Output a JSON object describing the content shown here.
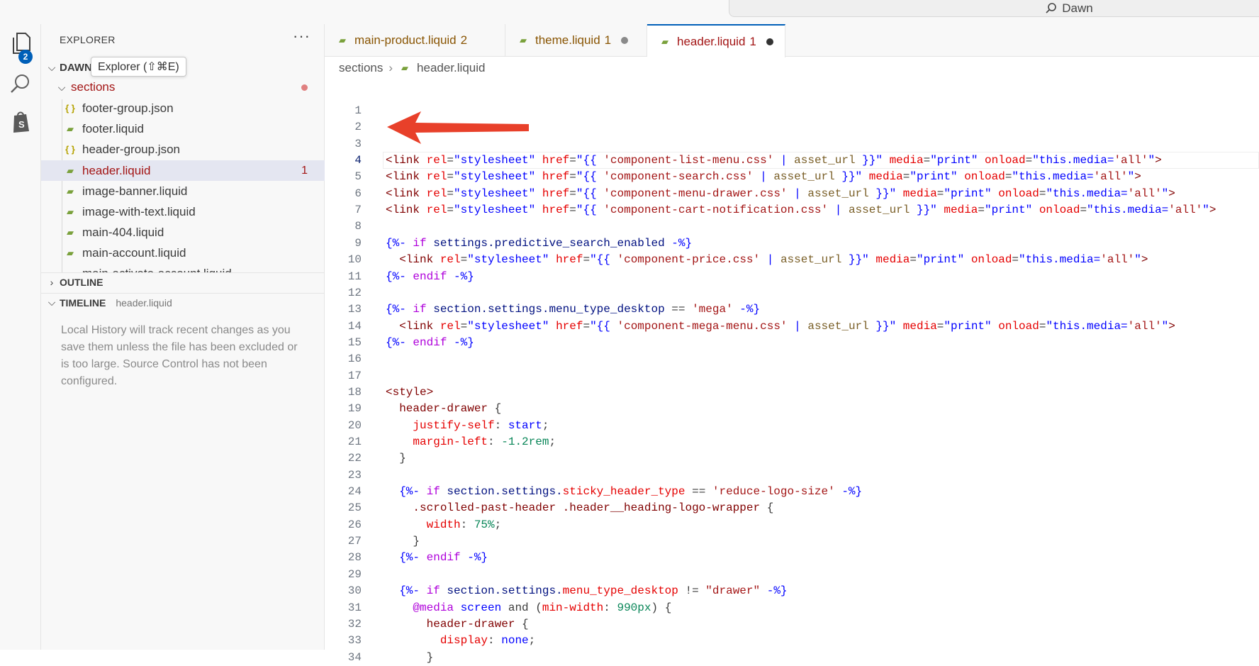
{
  "window": {
    "search_label": "Dawn"
  },
  "activity_bar": {
    "explorer_badge": "2"
  },
  "sidebar": {
    "header": "EXPLORER",
    "more": "···",
    "root_label": "DAWN",
    "tooltip": "Explorer (⇧⌘E)",
    "folder": "sections",
    "files": [
      {
        "name": "footer-group.json",
        "type": "json",
        "count": ""
      },
      {
        "name": "footer.liquid",
        "type": "liquid",
        "count": ""
      },
      {
        "name": "header-group.json",
        "type": "json",
        "count": ""
      },
      {
        "name": "header.liquid",
        "type": "liquid",
        "count": "1"
      },
      {
        "name": "image-banner.liquid",
        "type": "liquid",
        "count": ""
      },
      {
        "name": "image-with-text.liquid",
        "type": "liquid",
        "count": ""
      },
      {
        "name": "main-404.liquid",
        "type": "liquid",
        "count": ""
      },
      {
        "name": "main-account.liquid",
        "type": "liquid",
        "count": ""
      },
      {
        "name": "main-activate-account.liquid",
        "type": "liquid",
        "count": ""
      }
    ],
    "outline": "OUTLINE",
    "timeline": "TIMELINE",
    "timeline_file": "header.liquid",
    "timeline_text": "Local History will track recent changes as you save them unless the file has been excluded or is too large. Source Control has not been configured."
  },
  "tabs": [
    {
      "name": "main-product.liquid",
      "count": "2",
      "dot": false
    },
    {
      "name": "theme.liquid",
      "count": "1",
      "dot": true
    },
    {
      "name": "header.liquid",
      "count": "1",
      "dot": true
    }
  ],
  "breadcrumb": {
    "folder": "sections",
    "file": "header.liquid"
  },
  "code": {
    "current_line": 4,
    "lines": [
      [],
      [],
      [],
      [
        [
          "t",
          "<link "
        ],
        [
          "a",
          "rel"
        ],
        [
          "c",
          "="
        ],
        [
          "s",
          "\"stylesheet\" "
        ],
        [
          "a",
          "href"
        ],
        [
          "c",
          "="
        ],
        [
          "s",
          "\"{{ "
        ],
        [
          "q",
          "'component-list-menu.css'"
        ],
        [
          "s",
          " | "
        ],
        [
          "f",
          "asset_url"
        ],
        [
          "s",
          " }}\" "
        ],
        [
          "a",
          "media"
        ],
        [
          "c",
          "="
        ],
        [
          "s",
          "\"print\" "
        ],
        [
          "a",
          "onload"
        ],
        [
          "c",
          "="
        ],
        [
          "s",
          "\"this.media="
        ],
        [
          "q",
          "'all'"
        ],
        [
          "s",
          "\""
        ],
        [
          "t",
          ">"
        ]
      ],
      [
        [
          "t",
          "<link "
        ],
        [
          "a",
          "rel"
        ],
        [
          "c",
          "="
        ],
        [
          "s",
          "\"stylesheet\" "
        ],
        [
          "a",
          "href"
        ],
        [
          "c",
          "="
        ],
        [
          "s",
          "\"{{ "
        ],
        [
          "q",
          "'component-search.css'"
        ],
        [
          "s",
          " | "
        ],
        [
          "f",
          "asset_url"
        ],
        [
          "s",
          " }}\" "
        ],
        [
          "a",
          "media"
        ],
        [
          "c",
          "="
        ],
        [
          "s",
          "\"print\" "
        ],
        [
          "a",
          "onload"
        ],
        [
          "c",
          "="
        ],
        [
          "s",
          "\"this.media="
        ],
        [
          "q",
          "'all'"
        ],
        [
          "s",
          "\""
        ],
        [
          "t",
          ">"
        ]
      ],
      [
        [
          "t",
          "<link "
        ],
        [
          "a",
          "rel"
        ],
        [
          "c",
          "="
        ],
        [
          "s",
          "\"stylesheet\" "
        ],
        [
          "a",
          "href"
        ],
        [
          "c",
          "="
        ],
        [
          "s",
          "\"{{ "
        ],
        [
          "q",
          "'component-menu-drawer.css'"
        ],
        [
          "s",
          " | "
        ],
        [
          "f",
          "asset_url"
        ],
        [
          "s",
          " }}\" "
        ],
        [
          "a",
          "media"
        ],
        [
          "c",
          "="
        ],
        [
          "s",
          "\"print\" "
        ],
        [
          "a",
          "onload"
        ],
        [
          "c",
          "="
        ],
        [
          "s",
          "\"this.media="
        ],
        [
          "q",
          "'all'"
        ],
        [
          "s",
          "\""
        ],
        [
          "t",
          ">"
        ]
      ],
      [
        [
          "t",
          "<link "
        ],
        [
          "a",
          "rel"
        ],
        [
          "c",
          "="
        ],
        [
          "s",
          "\"stylesheet\" "
        ],
        [
          "a",
          "href"
        ],
        [
          "c",
          "="
        ],
        [
          "s",
          "\"{{ "
        ],
        [
          "q",
          "'component-cart-notification.css'"
        ],
        [
          "s",
          " | "
        ],
        [
          "f",
          "asset_url"
        ],
        [
          "s",
          " }}\" "
        ],
        [
          "a",
          "media"
        ],
        [
          "c",
          "="
        ],
        [
          "s",
          "\"print\" "
        ],
        [
          "a",
          "onload"
        ],
        [
          "c",
          "="
        ],
        [
          "s",
          "\"this.media="
        ],
        [
          "q",
          "'all'"
        ],
        [
          "s",
          "\""
        ],
        [
          "t",
          ">"
        ]
      ],
      [],
      [
        [
          "k",
          "{%- "
        ],
        [
          "p",
          "if "
        ],
        [
          "v",
          "settings.predictive_search_enabled"
        ],
        [
          "k",
          " -%}"
        ]
      ],
      [
        [
          "c",
          "  "
        ],
        [
          "t",
          "<link "
        ],
        [
          "a",
          "rel"
        ],
        [
          "c",
          "="
        ],
        [
          "s",
          "\"stylesheet\" "
        ],
        [
          "a",
          "href"
        ],
        [
          "c",
          "="
        ],
        [
          "s",
          "\"{{ "
        ],
        [
          "q",
          "'component-price.css'"
        ],
        [
          "s",
          " | "
        ],
        [
          "f",
          "asset_url"
        ],
        [
          "s",
          " }}\" "
        ],
        [
          "a",
          "media"
        ],
        [
          "c",
          "="
        ],
        [
          "s",
          "\"print\" "
        ],
        [
          "a",
          "onload"
        ],
        [
          "c",
          "="
        ],
        [
          "s",
          "\"this.media="
        ],
        [
          "q",
          "'all'"
        ],
        [
          "s",
          "\""
        ],
        [
          "t",
          ">"
        ]
      ],
      [
        [
          "k",
          "{%- "
        ],
        [
          "p",
          "endif"
        ],
        [
          "k",
          " -%}"
        ]
      ],
      [],
      [
        [
          "k",
          "{%- "
        ],
        [
          "p",
          "if "
        ],
        [
          "v",
          "section.settings.menu_type_desktop"
        ],
        [
          "c",
          " == "
        ],
        [
          "q",
          "'mega'"
        ],
        [
          "k",
          " -%}"
        ]
      ],
      [
        [
          "c",
          "  "
        ],
        [
          "t",
          "<link "
        ],
        [
          "a",
          "rel"
        ],
        [
          "c",
          "="
        ],
        [
          "s",
          "\"stylesheet\" "
        ],
        [
          "a",
          "href"
        ],
        [
          "c",
          "="
        ],
        [
          "s",
          "\"{{ "
        ],
        [
          "q",
          "'component-mega-menu.css'"
        ],
        [
          "s",
          " | "
        ],
        [
          "f",
          "asset_url"
        ],
        [
          "s",
          " }}\" "
        ],
        [
          "a",
          "media"
        ],
        [
          "c",
          "="
        ],
        [
          "s",
          "\"print\" "
        ],
        [
          "a",
          "onload"
        ],
        [
          "c",
          "="
        ],
        [
          "s",
          "\"this.media="
        ],
        [
          "q",
          "'all'"
        ],
        [
          "s",
          "\""
        ],
        [
          "t",
          ">"
        ]
      ],
      [
        [
          "k",
          "{%- "
        ],
        [
          "p",
          "endif"
        ],
        [
          "k",
          " -%}"
        ]
      ],
      [],
      [],
      [
        [
          "t",
          "<style>"
        ]
      ],
      [
        [
          "c",
          "  "
        ],
        [
          "t",
          "header-drawer"
        ],
        [
          "c",
          " {"
        ]
      ],
      [
        [
          "c",
          "    "
        ],
        [
          "a",
          "justify-self"
        ],
        [
          "c",
          ": "
        ],
        [
          "s",
          "start"
        ],
        [
          "c",
          ";"
        ]
      ],
      [
        [
          "c",
          "    "
        ],
        [
          "a",
          "margin-left"
        ],
        [
          "c",
          ": "
        ],
        [
          "n",
          "-1.2rem"
        ],
        [
          "c",
          ";"
        ]
      ],
      [
        [
          "c",
          "  }"
        ]
      ],
      [],
      [
        [
          "c",
          "  "
        ],
        [
          "k",
          "{%- "
        ],
        [
          "p",
          "if "
        ],
        [
          "v",
          "section.settings."
        ],
        [
          "a",
          "sticky_header_type"
        ],
        [
          "c",
          " == "
        ],
        [
          "q",
          "'reduce-logo-size'"
        ],
        [
          "k",
          " -%}"
        ]
      ],
      [
        [
          "c",
          "    "
        ],
        [
          "t",
          ".scrolled-past-header .header__heading-logo-wrapper"
        ],
        [
          "c",
          " {"
        ]
      ],
      [
        [
          "c",
          "      "
        ],
        [
          "a",
          "width"
        ],
        [
          "c",
          ": "
        ],
        [
          "n",
          "75%"
        ],
        [
          "c",
          ";"
        ]
      ],
      [
        [
          "c",
          "    }"
        ]
      ],
      [
        [
          "c",
          "  "
        ],
        [
          "k",
          "{%- "
        ],
        [
          "p",
          "endif"
        ],
        [
          "k",
          " -%}"
        ]
      ],
      [],
      [
        [
          "c",
          "  "
        ],
        [
          "k",
          "{%- "
        ],
        [
          "p",
          "if "
        ],
        [
          "v",
          "section.settings."
        ],
        [
          "a",
          "menu_type_desktop"
        ],
        [
          "c",
          " != "
        ],
        [
          "q",
          "\"drawer\""
        ],
        [
          "k",
          " -%}"
        ]
      ],
      [
        [
          "c",
          "    "
        ],
        [
          "p",
          "@media "
        ],
        [
          "s",
          "screen"
        ],
        [
          "c",
          " and ("
        ],
        [
          "a",
          "min-width"
        ],
        [
          "c",
          ": "
        ],
        [
          "n",
          "990px"
        ],
        [
          "c",
          ") {"
        ]
      ],
      [
        [
          "c",
          "      "
        ],
        [
          "t",
          "header-drawer"
        ],
        [
          "c",
          " {"
        ]
      ],
      [
        [
          "c",
          "        "
        ],
        [
          "a",
          "display"
        ],
        [
          "c",
          ": "
        ],
        [
          "s",
          "none"
        ],
        [
          "c",
          ";"
        ]
      ],
      [
        [
          "c",
          "      }"
        ]
      ]
    ]
  },
  "colors": {
    "accent": "#005fb8",
    "arrow": "#e8402a",
    "modified": "#a31515"
  }
}
